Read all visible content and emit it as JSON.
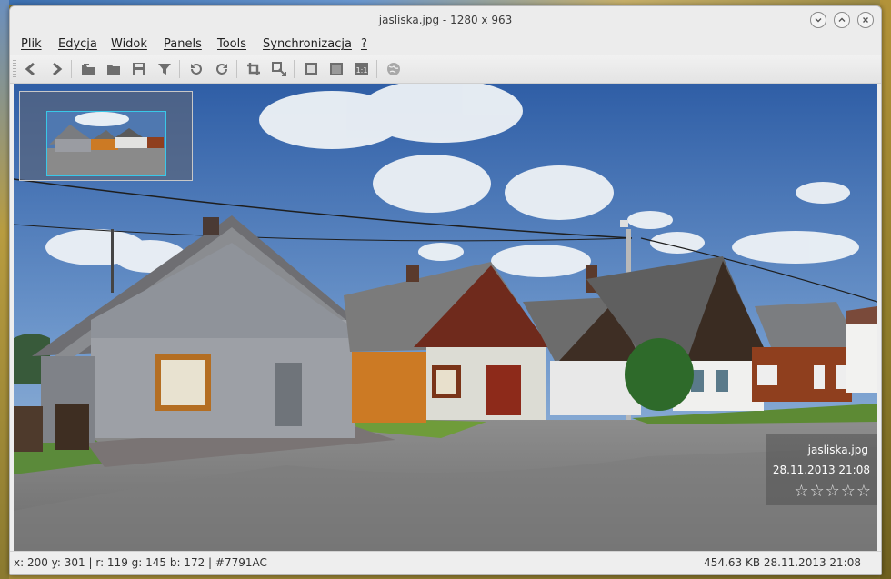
{
  "window": {
    "title": "jasliska.jpg  - 1280 x 963"
  },
  "menu": [
    "Plik",
    "Edycja",
    "Widok",
    "Panels",
    "Tools",
    "Synchronizacja",
    "?"
  ],
  "toolbar": {
    "icons": [
      "back-arrow-icon",
      "forward-arrow-icon",
      "folder-open-icon",
      "folder-icon",
      "save-icon",
      "filter-icon",
      "rotate-left-icon",
      "rotate-right-icon",
      "crop-icon",
      "resize-icon",
      "fit-window-icon",
      "fullscreen-icon",
      "actual-size-icon",
      "globe-icon"
    ]
  },
  "overlay": {
    "filename": "jasliska.jpg",
    "datetime": "28.11.2013 21:08",
    "rating_stars": "☆☆☆☆☆",
    "rating": 0
  },
  "status": {
    "left": "x: 200 y: 301 | r: 119 g: 145 b: 172 | #7791AC",
    "right": "454.63 KB  28.11.2013 21:08"
  },
  "colors": {
    "sampled": "#7791AC",
    "minimap_border": "#39c8e8"
  }
}
